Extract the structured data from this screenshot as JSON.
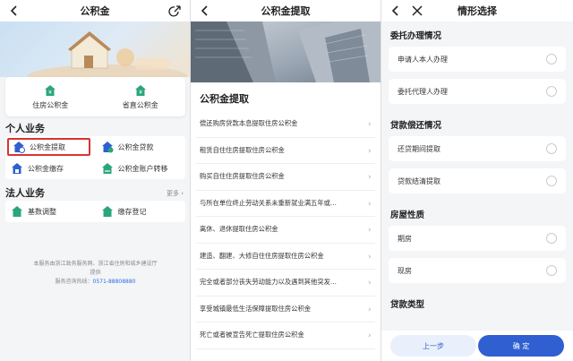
{
  "panel1": {
    "title": "公积金",
    "quick": [
      {
        "label": "住房公积金",
        "icon": "house-shield-icon"
      },
      {
        "label": "省直公积金",
        "icon": "house-shield-icon"
      }
    ],
    "personal": {
      "title": "个人业务",
      "items": [
        {
          "label": "公积金提取",
          "icon": "house-withdraw-icon",
          "highlight": true
        },
        {
          "label": "公积金贷款",
          "icon": "house-loan-icon"
        },
        {
          "label": "公积金缴存",
          "icon": "house-deposit-icon"
        },
        {
          "label": "公积金账户转移",
          "icon": "house-transfer-icon"
        }
      ]
    },
    "corporate": {
      "title": "法人业务",
      "more": "更多",
      "items": [
        {
          "label": "基数调整",
          "icon": "house-adjust-icon"
        },
        {
          "label": "缴存登记",
          "icon": "house-register-icon"
        }
      ]
    },
    "footer": {
      "line1": "本服务由浙江政务服务网、浙江省住房和城乡建设厅",
      "line2": "提供",
      "hotline_label": "服务咨询热线：",
      "hotline": "0571-88808880"
    }
  },
  "panel2": {
    "title": "公积金提取",
    "section_title": "公积金提取",
    "items": [
      "偿还购房贷款本息提取住房公积金",
      "租赁自住住房提取住房公积金",
      "购买自住住房提取住房公积金",
      "与所在单位终止劳动关系未重新就业满五年或...",
      "离休、退休提取住房公积金",
      "建造、翻建、大修自住住房提取住房公积金",
      "完全或者部分丧失劳动能力以及遇到其他突发...",
      "享受城镇最低生活保障提取住房公积金",
      "死亡或者被宣告死亡提取住房公积金"
    ]
  },
  "panel3": {
    "title": "情形选择",
    "groups": [
      {
        "title": "委托办理情况",
        "options": [
          "申请人本人办理",
          "委托代理人办理"
        ]
      },
      {
        "title": "贷款偿还情况",
        "options": [
          "还贷期间提取",
          "贷款结清提取"
        ]
      },
      {
        "title": "房屋性质",
        "options": [
          "期房",
          "现房"
        ]
      },
      {
        "title": "贷款类型",
        "options": []
      }
    ],
    "prev_label": "上一步",
    "ok_label": "确 定"
  },
  "colors": {
    "accent": "#2f5fd1",
    "green": "#2aa67a",
    "highlight": "#d93333"
  }
}
